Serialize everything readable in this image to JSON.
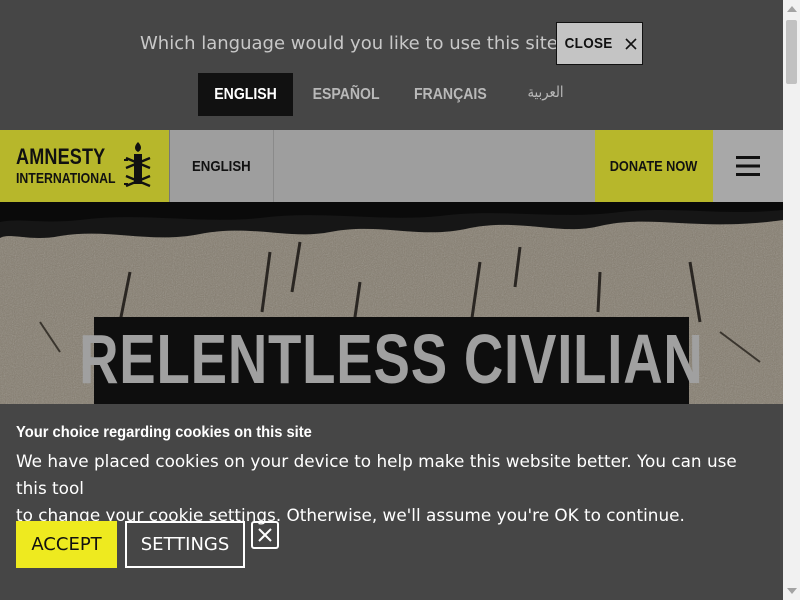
{
  "language_bar": {
    "question": "Which language would you like to use this site in?",
    "close_label": "CLOSE",
    "close_icon": "close-icon",
    "options": [
      {
        "label": "ENGLISH",
        "active": true
      },
      {
        "label": "ESPAÑOL",
        "active": false
      },
      {
        "label": "FRANÇAIS",
        "active": false
      },
      {
        "label": "العربية",
        "active": false
      }
    ]
  },
  "header": {
    "logo_line1": "AMNESTY",
    "logo_line2": "INTERNATIONAL",
    "logo_icon": "candle-icon",
    "language": "ENGLISH",
    "donate_label": "DONATE NOW",
    "menu_icon": "hamburger-menu-icon"
  },
  "hero": {
    "title": "RELENTLESS CIVILIAN"
  },
  "cookie_banner": {
    "title": "Your choice regarding cookies on this site",
    "body_line1": "We have placed cookies on your device to help make this website better. You can use this tool",
    "body_line2": "to change your cookie settings. Otherwise, we'll assume you're OK to continue.",
    "accept_label": "ACCEPT",
    "settings_label": "SETTINGS",
    "dismiss_icon": "close-icon"
  },
  "colors": {
    "brand_yellow": "#b7b72b",
    "accept_yellow": "#eeea1f",
    "bar_grey": "#464646",
    "header_grey": "#9e9e9e"
  }
}
